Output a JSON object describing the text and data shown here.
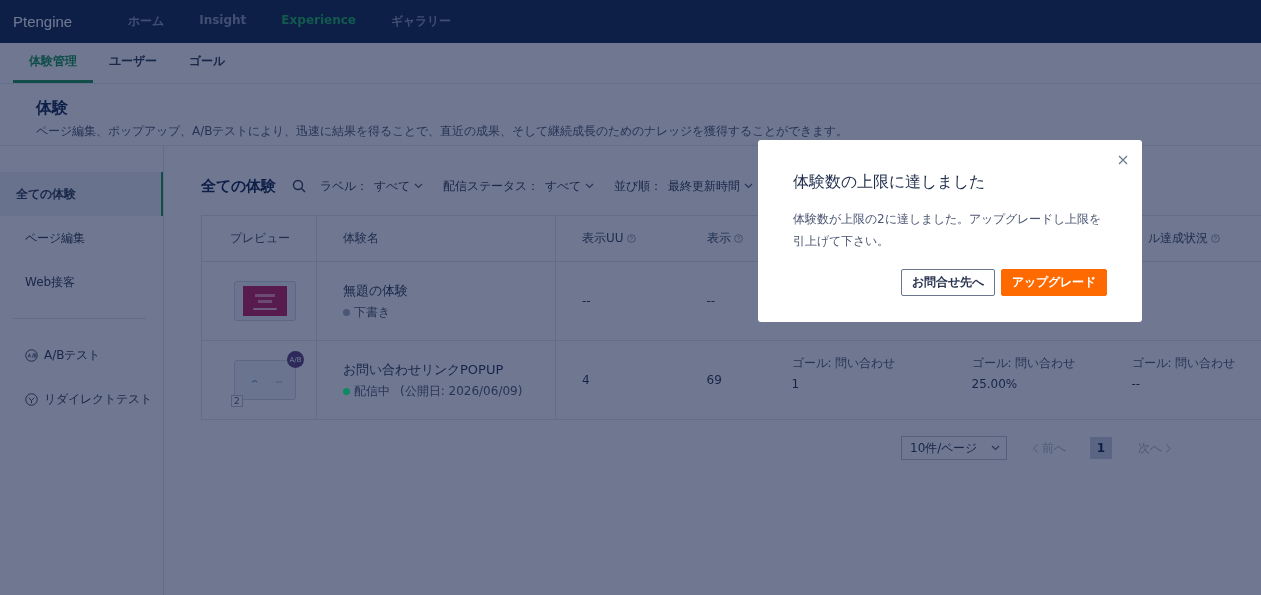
{
  "nav": {
    "logo": "Ptengine",
    "items": [
      {
        "label": "ホーム",
        "selected": false
      },
      {
        "label": "Insight",
        "selected": false
      },
      {
        "label": "Experience",
        "selected": true
      },
      {
        "label": "ギャラリー",
        "selected": false
      }
    ]
  },
  "subtabs": [
    {
      "label": "体験管理",
      "selected": true
    },
    {
      "label": "ユーザー",
      "selected": false
    },
    {
      "label": "ゴール",
      "selected": false
    }
  ],
  "header": {
    "title": "体験",
    "description": "ページ編集、ポップアップ、A/Bテストにより、迅速に結果を得ることで、直近の成果、そして継続成長のためのナレッジを獲得することができます。"
  },
  "sidebar": {
    "items": [
      {
        "kind": "text",
        "label": "全ての体験",
        "selected": true
      },
      {
        "kind": "text",
        "label": "ページ編集",
        "selected": false
      },
      {
        "kind": "text",
        "label": "Web接客",
        "selected": false
      },
      {
        "kind": "divider"
      },
      {
        "kind": "ab",
        "label": "A/Bテスト",
        "selected": false
      },
      {
        "kind": "redirect",
        "label": "リダイレクトテスト",
        "selected": false
      }
    ]
  },
  "toolbar": {
    "title": "全ての体験",
    "filters": [
      {
        "label": "ラベル：",
        "value": "すべて"
      },
      {
        "label": "配信ステータス：",
        "value": "すべて"
      },
      {
        "label": "並び順：",
        "value": "最終更新時間"
      }
    ]
  },
  "table": {
    "columns": [
      {
        "label": "プレビュー"
      },
      {
        "label": "体験名"
      },
      {
        "label": "表示UU",
        "help": true
      },
      {
        "label": "表示",
        "help": true
      },
      {},
      {},
      {
        "label": "ル達成状況",
        "help": true
      }
    ],
    "rows": [
      {
        "kind": "banner",
        "name": "無題の体験",
        "status": {
          "label": "下書き",
          "color": "#4a5678"
        },
        "metrics": [
          {
            "value": "--"
          },
          {
            "value": "--"
          }
        ]
      },
      {
        "kind": "popup",
        "ab_badge": "A/B",
        "variant_count": "2",
        "name": "お問い合わせリンクPOPUP",
        "status": {
          "label": "配信中",
          "color": "#0e8a63"
        },
        "published": "(公開日: 2026/06/09)",
        "metrics": [
          {
            "value": "4"
          },
          {
            "value": "69"
          },
          {
            "label": "ゴール: 問い合わせ",
            "value": "1"
          },
          {
            "label": "ゴール: 問い合わせ",
            "value": "25.00%"
          },
          {
            "label": "ゴール: 問い合わせ",
            "value": "--"
          }
        ]
      }
    ]
  },
  "pagination": {
    "page_size": "10件/ページ",
    "prev": {
      "label": "前へ",
      "disabled": true
    },
    "pages": [
      {
        "label": "1",
        "selected": true
      }
    ],
    "next": {
      "label": "次へ",
      "disabled": true
    }
  },
  "modal": {
    "title": "体験数の上限に達しました",
    "message": "体験数が上限の2に達しました。アップグレードし上限を引上げて下さい。",
    "buttons": [
      {
        "label": "お問合せ先へ",
        "kind": "secondary"
      },
      {
        "label": "アップグレード",
        "kind": "primary"
      }
    ]
  }
}
